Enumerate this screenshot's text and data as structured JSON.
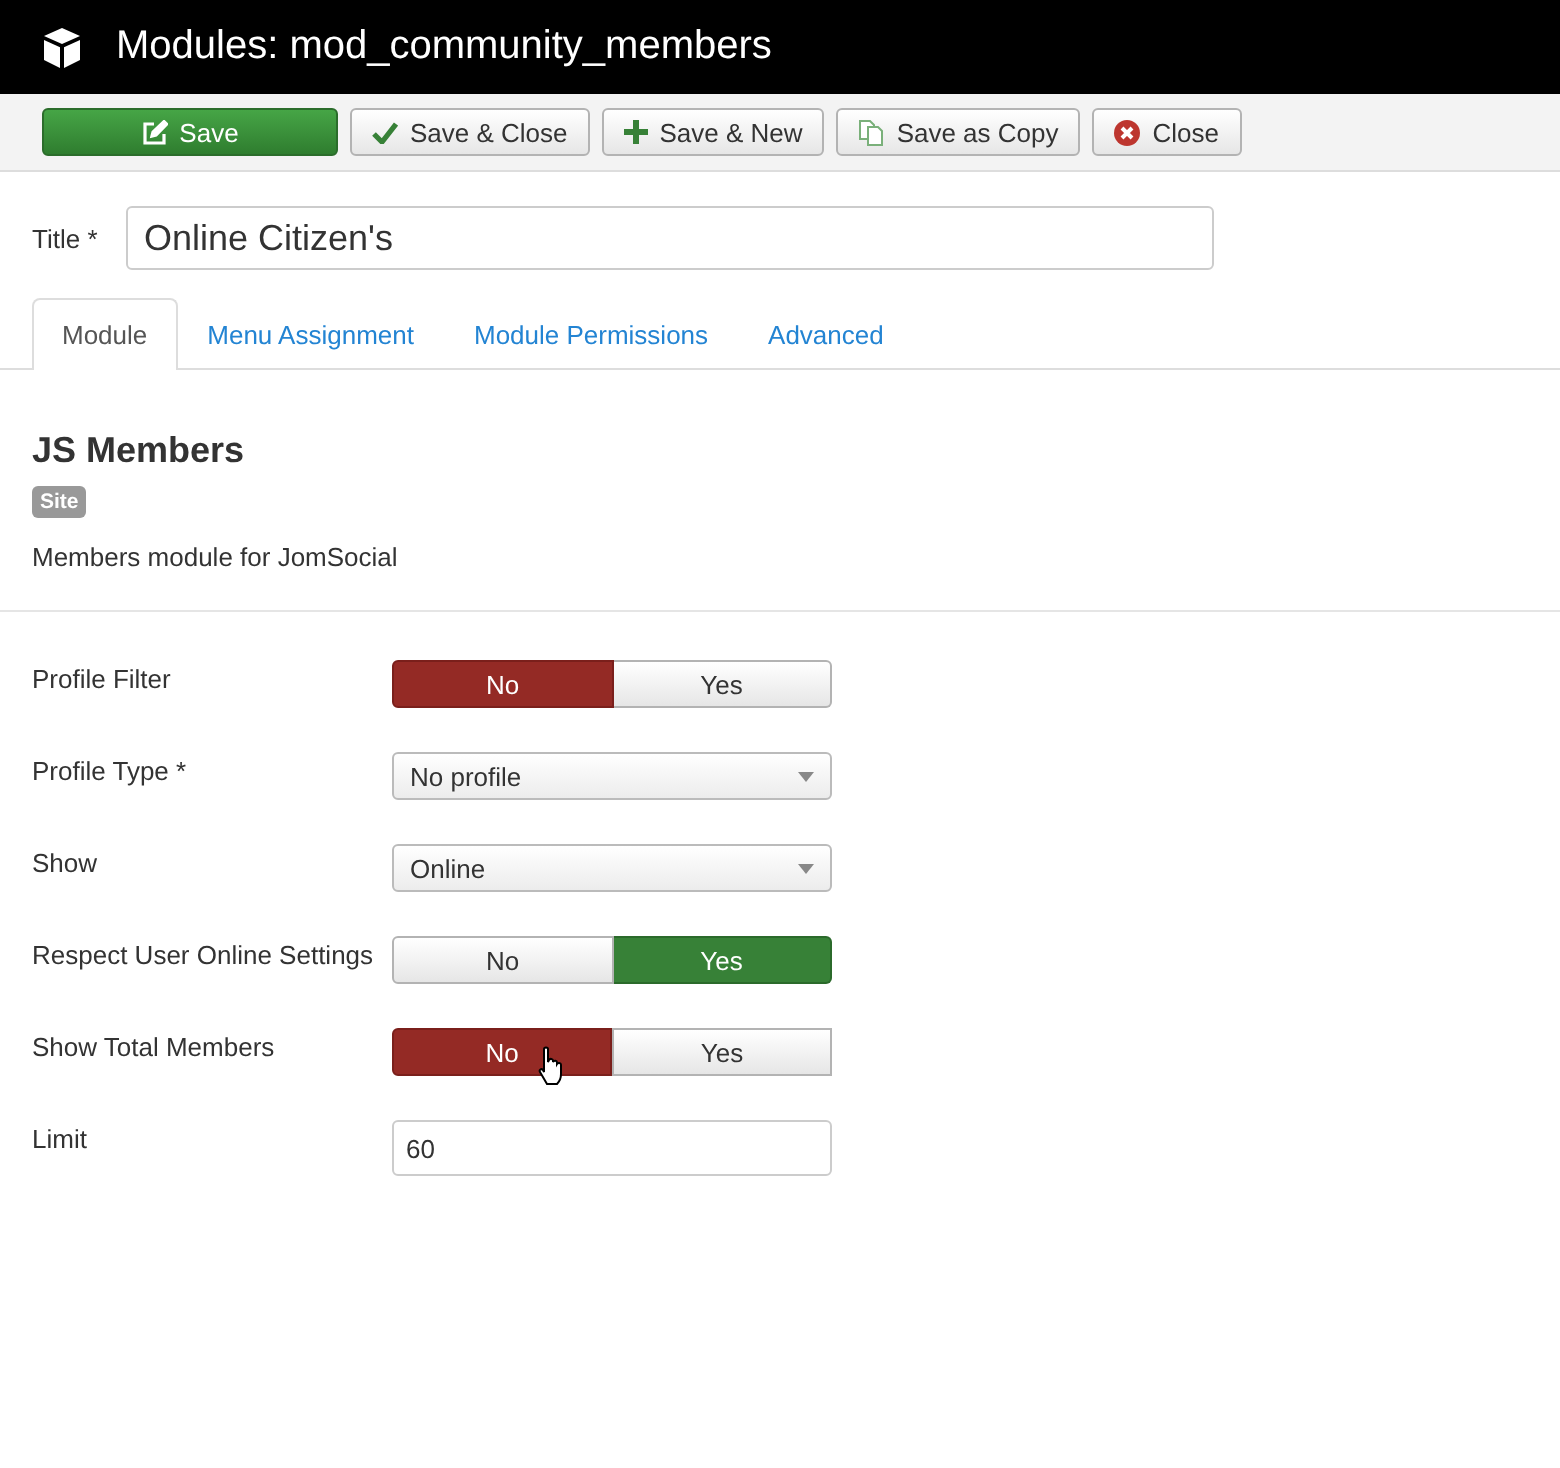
{
  "window": {
    "title": "Modules: mod_community_members"
  },
  "toolbar": [
    {
      "label": "Save",
      "kind": "primary"
    },
    {
      "label": "Save & Close",
      "kind": "default"
    },
    {
      "label": "Save & New",
      "kind": "default"
    },
    {
      "label": "Save as Copy",
      "kind": "default"
    },
    {
      "label": "Close",
      "kind": "default"
    }
  ],
  "title_field": {
    "label": "Title *",
    "value": "Online Citizen's"
  },
  "tabs": [
    {
      "label": "Module",
      "selected": true
    },
    {
      "label": "Menu Assignment",
      "selected": false
    },
    {
      "label": "Module Permissions",
      "selected": false
    },
    {
      "label": "Advanced",
      "selected": false
    }
  ],
  "module": {
    "name": "JS Members",
    "badge": "Site",
    "description": "Members module for JomSocial"
  },
  "fields": [
    {
      "label": "Profile Filter",
      "kind": "toggle",
      "options": [
        {
          "label": "No",
          "selected": true
        },
        {
          "label": "Yes",
          "selected": false
        }
      ]
    },
    {
      "label": "Profile Type *",
      "kind": "select",
      "value": "No profile"
    },
    {
      "label": "Show",
      "kind": "select",
      "value": "Online"
    },
    {
      "label": "Respect User Online Settings",
      "kind": "toggle",
      "options": [
        {
          "label": "No",
          "selected": false
        },
        {
          "label": "Yes",
          "selected": true
        }
      ]
    },
    {
      "label": "Show Total Members",
      "kind": "toggle",
      "options": [
        {
          "label": "No",
          "selected": true
        },
        {
          "label": "Yes",
          "selected": false
        }
      ],
      "hovered": true
    },
    {
      "label": "Limit",
      "kind": "text",
      "value": "60"
    }
  ]
}
